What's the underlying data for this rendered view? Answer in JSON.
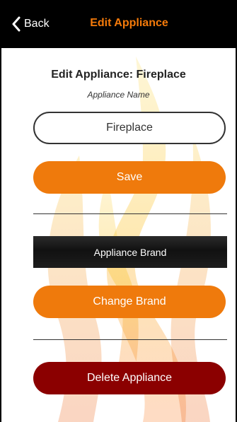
{
  "nav": {
    "back_label": "Back",
    "title": "Edit Appliance"
  },
  "main": {
    "page_title": "Edit Appliance: Fireplace",
    "name_label": "Appliance Name",
    "name_value": "Fireplace",
    "save_label": "Save",
    "brand_header": "Appliance Brand",
    "change_brand_label": "Change Brand",
    "delete_label": "Delete Appliance"
  },
  "colors": {
    "accent": "#ef7a0c",
    "danger": "#8b0000",
    "navbar": "#000000"
  },
  "icons": {
    "back": "chevron-left-icon",
    "background": "flame-icon"
  }
}
